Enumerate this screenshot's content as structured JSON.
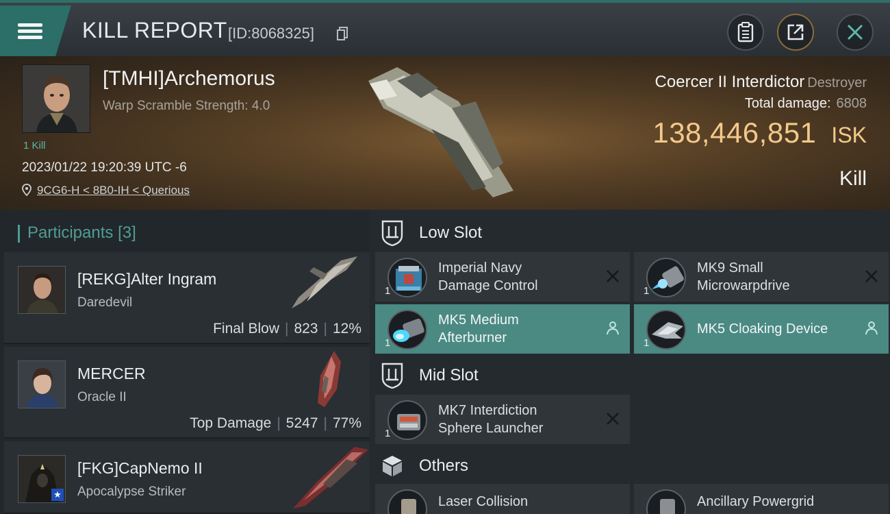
{
  "header": {
    "title": "KILL REPORT",
    "report_id": "[ID:8068325]"
  },
  "victim": {
    "name": "[TMHI]Archemorus",
    "warp_scramble": "Warp Scramble Strength: 4.0",
    "kill_count": "1 Kill",
    "datetime": "2023/01/22 19:20:39 UTC -6",
    "location": "9CG6-H < 8B0-IH < Querious",
    "ship_name": "Coercer II Interdictor",
    "ship_class": "Destroyer",
    "total_damage_label": "Total damage:",
    "total_damage": "6808",
    "isk_value": "138,446,851",
    "isk_unit": "ISK",
    "result": "Kill"
  },
  "participants": {
    "label": "Participants",
    "count": "[3]",
    "items": [
      {
        "name": "[REKG]Alter Ingram",
        "ship": "Daredevil",
        "tag": "Final Blow",
        "damage": "823",
        "percent": "12%"
      },
      {
        "name": "MERCER",
        "ship": "Oracle II",
        "tag": "Top Damage",
        "damage": "5247",
        "percent": "77%"
      },
      {
        "name": "[FKG]CapNemo II",
        "ship": "Apocalypse Striker",
        "tag": "",
        "damage": "",
        "percent": ""
      }
    ]
  },
  "slots": {
    "low": {
      "label": "Low Slot",
      "modules": [
        {
          "line1": "Imperial Navy",
          "line2": "Damage Control",
          "qty": "1",
          "state": "destroyed"
        },
        {
          "line1": "MK9 Small",
          "line2": "Microwarpdrive",
          "qty": "1",
          "state": "destroyed"
        },
        {
          "line1": "MK5 Medium",
          "line2": "Afterburner",
          "qty": "1",
          "state": "dropped"
        },
        {
          "line1": "MK5 Cloaking Device",
          "line2": "",
          "qty": "1",
          "state": "dropped"
        }
      ]
    },
    "mid": {
      "label": "Mid Slot",
      "modules": [
        {
          "line1": "MK7 Interdiction",
          "line2": "Sphere Launcher",
          "qty": "1",
          "state": "destroyed"
        }
      ]
    },
    "others": {
      "label": "Others",
      "modules": [
        {
          "line1": "Laser Collision",
          "line2": "",
          "qty": "",
          "state": "destroyed"
        },
        {
          "line1": "Ancillary Powergrid",
          "line2": "",
          "qty": "",
          "state": "destroyed"
        }
      ]
    }
  },
  "colors": {
    "accent_teal": "#4f9d94",
    "dropped_teal": "#4a8a83",
    "isk_gold": "#f4c98a"
  }
}
